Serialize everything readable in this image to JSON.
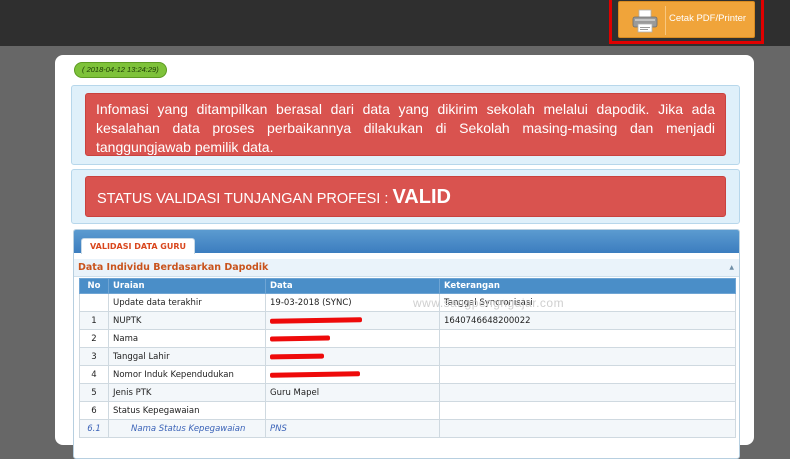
{
  "toolbar": {
    "print_label": "Cetak PDF/Printer",
    "print_icon": "printer-icon"
  },
  "timestamp": "( 2018-04-12 13:24:29)",
  "notice": {
    "text": "Infomasi yang ditampilkan berasal dari data yang dikirim sekolah melalui dapodik. Jika ada kesalahan data proses perbaikannya dilakukan di Sekolah masing-masing dan menjadi tanggungjawab pemilik data."
  },
  "status": {
    "label": "STATUS VALIDASI TUNJANGAN PROFESI :",
    "value": "VALID"
  },
  "tab_label": "VALIDASI DATA GURU",
  "section_title": "Data Individu Berdasarkan Dapodik",
  "table": {
    "headers": [
      "No",
      "Uraian",
      "Data",
      "Keterangan"
    ],
    "rows": [
      {
        "no": "",
        "uraian": "Update data terakhir",
        "data": "19-03-2018 (SYNC)",
        "ket": "Tanggal Syncronisasi"
      },
      {
        "no": "1",
        "uraian": "NUPTK",
        "data": "",
        "ket": "1640746648200022"
      },
      {
        "no": "2",
        "uraian": "Nama",
        "data": "",
        "ket": ""
      },
      {
        "no": "3",
        "uraian": "Tanggal Lahir",
        "data": "",
        "ket": ""
      },
      {
        "no": "4",
        "uraian": "Nomor Induk Kependudukan",
        "data": "",
        "ket": ""
      },
      {
        "no": "5",
        "uraian": "Jenis PTK",
        "data": "Guru Mapel",
        "ket": ""
      },
      {
        "no": "6",
        "uraian": "Status Kepegawaian",
        "data": "",
        "ket": ""
      },
      {
        "no": "6.1",
        "uraian": "Nama Status Kepegawaian",
        "data": "PNS",
        "ket": ""
      }
    ]
  },
  "watermark": "www.sangpengngajar.com",
  "colors": {
    "alert_red": "#d9534f",
    "accent_orange": "#f0a43a",
    "header_blue": "#4a8ec8",
    "highlight_red": "#e00000"
  }
}
